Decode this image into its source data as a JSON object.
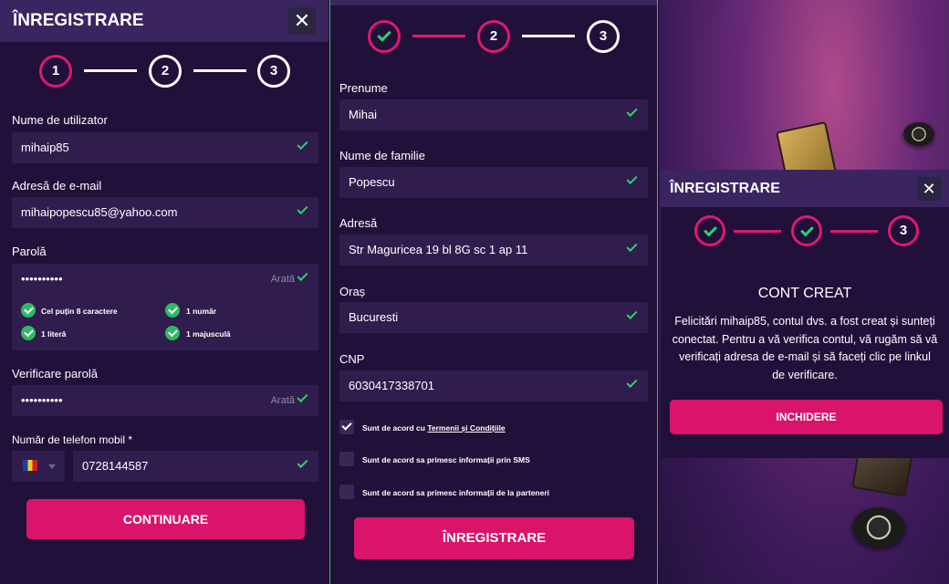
{
  "form1": {
    "title": "ÎNREGISTRARE",
    "steps": [
      "1",
      "2",
      "3"
    ],
    "fields": [
      {
        "label": "Nume de utilizator",
        "value": "mihaip85"
      },
      {
        "label": "Adresă de e-mail",
        "value": "mihaipopescu85@yahoo.com"
      },
      {
        "label": "Parolă",
        "value": "••••••••••",
        "show": "Arată"
      },
      {
        "label": "Verificare parolă",
        "value": "••••••••••",
        "show": "Arată"
      }
    ],
    "requirements": [
      "Cel puțin 8 caractere",
      "1 număr",
      "1 literă",
      "1 majusculă"
    ],
    "phone_label": "Număr de telefon mobil *",
    "phone_value": "0728144587",
    "continue_label": "CONTINUARE"
  },
  "form2": {
    "steps": [
      "2",
      "3"
    ],
    "fields": [
      {
        "label": "Prenume",
        "value": "Mihai"
      },
      {
        "label": "Nume de familie",
        "value": "Popescu"
      },
      {
        "label": "Adresă",
        "value": "Str Maguricea 19 bl 8G sc 1 ap 11"
      },
      {
        "label": "Oraș",
        "value": "Bucuresti"
      },
      {
        "label": "CNP",
        "value": "6030417338701"
      }
    ],
    "checkboxes": [
      {
        "text": "Sunt de acord cu ",
        "link": "Termenii și Condițiile",
        "checked": true
      },
      {
        "text": "Sunt de acord sa primesc informații prin SMS",
        "checked": false
      },
      {
        "text": "Sunt de acord sa primesc informații de la parteneri",
        "checked": false
      }
    ],
    "register_label": "ÎNREGISTRARE"
  },
  "modal": {
    "title": "ÎNREGISTRARE",
    "step3": "3",
    "heading": "CONT CREAT",
    "message": "Felicitări mihaip85, contul dvs. a fost creat și sunteți conectat. Pentru a vă verifica contul, vă rugăm să vă verificați adresa de e-mail și să faceți clic pe linkul de verificare.",
    "close_label": "INCHIDERE"
  },
  "colors": {
    "accent": "#d9146a",
    "success": "#2fd26f",
    "panel": "#21103a"
  }
}
